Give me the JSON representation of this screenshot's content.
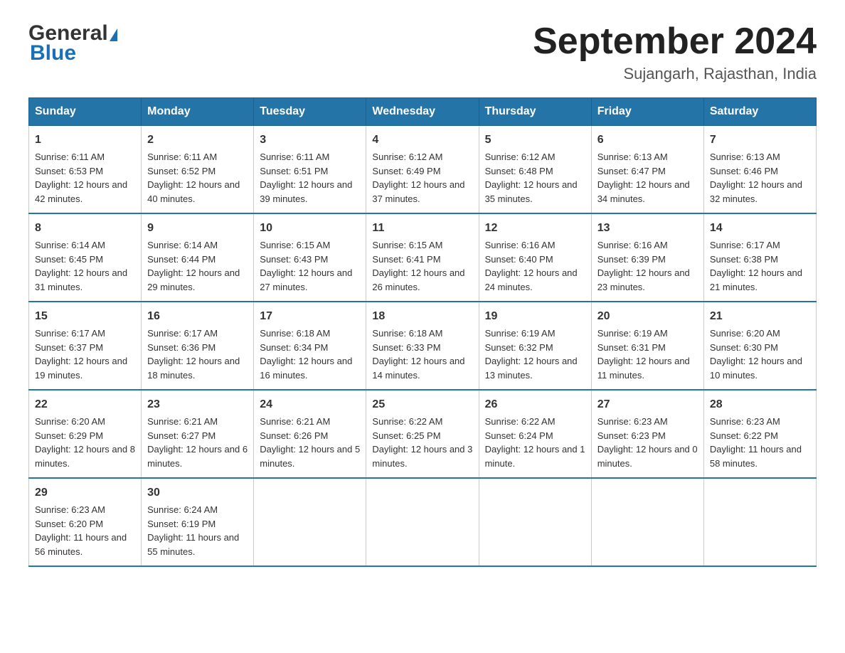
{
  "logo": {
    "general": "General",
    "blue": "Blue"
  },
  "title": "September 2024",
  "location": "Sujangarh, Rajasthan, India",
  "header": {
    "days": [
      "Sunday",
      "Monday",
      "Tuesday",
      "Wednesday",
      "Thursday",
      "Friday",
      "Saturday"
    ]
  },
  "weeks": [
    [
      {
        "day": "1",
        "sunrise": "6:11 AM",
        "sunset": "6:53 PM",
        "daylight": "12 hours and 42 minutes."
      },
      {
        "day": "2",
        "sunrise": "6:11 AM",
        "sunset": "6:52 PM",
        "daylight": "12 hours and 40 minutes."
      },
      {
        "day": "3",
        "sunrise": "6:11 AM",
        "sunset": "6:51 PM",
        "daylight": "12 hours and 39 minutes."
      },
      {
        "day": "4",
        "sunrise": "6:12 AM",
        "sunset": "6:49 PM",
        "daylight": "12 hours and 37 minutes."
      },
      {
        "day": "5",
        "sunrise": "6:12 AM",
        "sunset": "6:48 PM",
        "daylight": "12 hours and 35 minutes."
      },
      {
        "day": "6",
        "sunrise": "6:13 AM",
        "sunset": "6:47 PM",
        "daylight": "12 hours and 34 minutes."
      },
      {
        "day": "7",
        "sunrise": "6:13 AM",
        "sunset": "6:46 PM",
        "daylight": "12 hours and 32 minutes."
      }
    ],
    [
      {
        "day": "8",
        "sunrise": "6:14 AM",
        "sunset": "6:45 PM",
        "daylight": "12 hours and 31 minutes."
      },
      {
        "day": "9",
        "sunrise": "6:14 AM",
        "sunset": "6:44 PM",
        "daylight": "12 hours and 29 minutes."
      },
      {
        "day": "10",
        "sunrise": "6:15 AM",
        "sunset": "6:43 PM",
        "daylight": "12 hours and 27 minutes."
      },
      {
        "day": "11",
        "sunrise": "6:15 AM",
        "sunset": "6:41 PM",
        "daylight": "12 hours and 26 minutes."
      },
      {
        "day": "12",
        "sunrise": "6:16 AM",
        "sunset": "6:40 PM",
        "daylight": "12 hours and 24 minutes."
      },
      {
        "day": "13",
        "sunrise": "6:16 AM",
        "sunset": "6:39 PM",
        "daylight": "12 hours and 23 minutes."
      },
      {
        "day": "14",
        "sunrise": "6:17 AM",
        "sunset": "6:38 PM",
        "daylight": "12 hours and 21 minutes."
      }
    ],
    [
      {
        "day": "15",
        "sunrise": "6:17 AM",
        "sunset": "6:37 PM",
        "daylight": "12 hours and 19 minutes."
      },
      {
        "day": "16",
        "sunrise": "6:17 AM",
        "sunset": "6:36 PM",
        "daylight": "12 hours and 18 minutes."
      },
      {
        "day": "17",
        "sunrise": "6:18 AM",
        "sunset": "6:34 PM",
        "daylight": "12 hours and 16 minutes."
      },
      {
        "day": "18",
        "sunrise": "6:18 AM",
        "sunset": "6:33 PM",
        "daylight": "12 hours and 14 minutes."
      },
      {
        "day": "19",
        "sunrise": "6:19 AM",
        "sunset": "6:32 PM",
        "daylight": "12 hours and 13 minutes."
      },
      {
        "day": "20",
        "sunrise": "6:19 AM",
        "sunset": "6:31 PM",
        "daylight": "12 hours and 11 minutes."
      },
      {
        "day": "21",
        "sunrise": "6:20 AM",
        "sunset": "6:30 PM",
        "daylight": "12 hours and 10 minutes."
      }
    ],
    [
      {
        "day": "22",
        "sunrise": "6:20 AM",
        "sunset": "6:29 PM",
        "daylight": "12 hours and 8 minutes."
      },
      {
        "day": "23",
        "sunrise": "6:21 AM",
        "sunset": "6:27 PM",
        "daylight": "12 hours and 6 minutes."
      },
      {
        "day": "24",
        "sunrise": "6:21 AM",
        "sunset": "6:26 PM",
        "daylight": "12 hours and 5 minutes."
      },
      {
        "day": "25",
        "sunrise": "6:22 AM",
        "sunset": "6:25 PM",
        "daylight": "12 hours and 3 minutes."
      },
      {
        "day": "26",
        "sunrise": "6:22 AM",
        "sunset": "6:24 PM",
        "daylight": "12 hours and 1 minute."
      },
      {
        "day": "27",
        "sunrise": "6:23 AM",
        "sunset": "6:23 PM",
        "daylight": "12 hours and 0 minutes."
      },
      {
        "day": "28",
        "sunrise": "6:23 AM",
        "sunset": "6:22 PM",
        "daylight": "11 hours and 58 minutes."
      }
    ],
    [
      {
        "day": "29",
        "sunrise": "6:23 AM",
        "sunset": "6:20 PM",
        "daylight": "11 hours and 56 minutes."
      },
      {
        "day": "30",
        "sunrise": "6:24 AM",
        "sunset": "6:19 PM",
        "daylight": "11 hours and 55 minutes."
      },
      null,
      null,
      null,
      null,
      null
    ]
  ]
}
